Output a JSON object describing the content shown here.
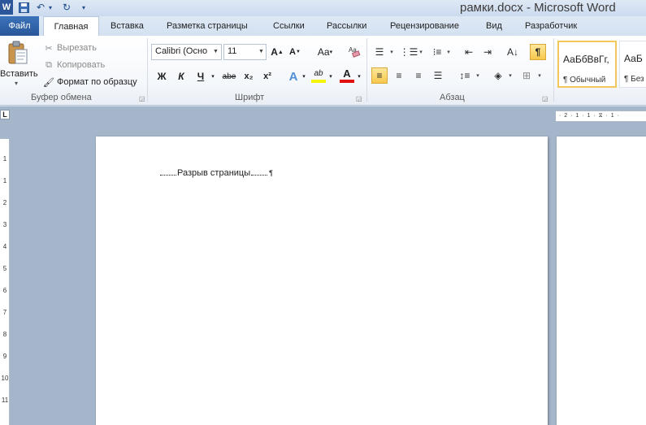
{
  "title_bar": {
    "document_title": "рамки.docx - Microsoft Word",
    "quick_access": {
      "app_icon": "W",
      "save_icon": "save-icon",
      "undo_icon": "undo-icon",
      "redo_icon": "redo-icon",
      "customize_icon": "customize-arrow-icon"
    }
  },
  "tabs": {
    "file": "Файл",
    "items": [
      "Главная",
      "Вставка",
      "Разметка страницы",
      "Ссылки",
      "Рассылки",
      "Рецензирование",
      "Вид",
      "Разработчик"
    ],
    "active": "Главная"
  },
  "clipboard": {
    "paste_label": "Вставить",
    "cut_label": "Вырезать",
    "copy_label": "Копировать",
    "painter_label": "Формат по образцу",
    "group_label": "Буфер обмена"
  },
  "font": {
    "font_name": "Calibri (Осно",
    "font_size": "11",
    "grow_label": "A",
    "shrink_label": "A",
    "case_label": "Aa",
    "bold_label": "Ж",
    "italic_label": "К",
    "underline_label": "Ч",
    "strike_label": "abe",
    "subscript_label": "x₂",
    "superscript_label": "x²",
    "effects_label": "A",
    "highlight_label": "ab",
    "color_label": "A",
    "group_label": "Шрифт",
    "highlight_color": "#f5f50a",
    "font_color": "#e01010"
  },
  "paragraph": {
    "group_label": "Абзац",
    "pilcrow_label": "¶",
    "active_toggle_color": "#f7c94d"
  },
  "styles": {
    "items": [
      {
        "sample": "АаБбВвГг,",
        "name": "¶ Обычный"
      },
      {
        "sample": "АаБ",
        "name": "¶ Без и"
      }
    ]
  },
  "ruler": {
    "corner_label": "L",
    "h_marks": "· 2 · 1 · 1 · ⧖ · 1 ·",
    "v_numbers": [
      "1",
      "1",
      "2",
      "3",
      "4",
      "5",
      "6",
      "7",
      "8",
      "9",
      "10",
      "11"
    ]
  },
  "document": {
    "page_break_text": "Разрыв страницы",
    "paragraph_mark": "¶"
  }
}
